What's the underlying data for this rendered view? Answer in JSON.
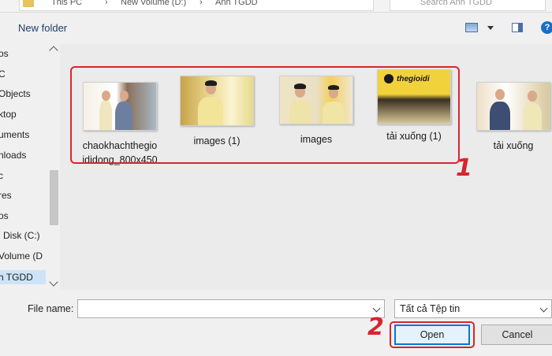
{
  "address": {
    "path_parts": [
      "This PC",
      "New Volume (D:)",
      "Anh TGDD"
    ],
    "separators": [
      "›",
      "›"
    ],
    "search_placeholder": "Search Anh TGDD"
  },
  "toolbar": {
    "new_folder": "New folder",
    "help": "?"
  },
  "nav": {
    "items": [
      "os",
      "C",
      "Objects",
      "ktop",
      "uments",
      "nloads",
      "c",
      "res",
      "os",
      "l Disk (C:)",
      "Volume (D",
      "h TGDD"
    ],
    "selected_index": 11
  },
  "files": [
    {
      "name_line1": "chaokhachthegio",
      "name_line2": "ididong_800x450"
    },
    {
      "name_line1": "images (1)",
      "name_line2": ""
    },
    {
      "name_line1": "images",
      "name_line2": ""
    },
    {
      "name_line1": "tải xuống (1)",
      "name_line2": ""
    },
    {
      "name_line1": "tải xuống",
      "name_line2": ""
    }
  ],
  "thumb4_logo": "thegioidi",
  "callouts": {
    "one": "1",
    "two": "2"
  },
  "bottom": {
    "file_name_label": "File name:",
    "file_name_value": "",
    "file_type": "Tất cả Tệp tin",
    "open": "Open",
    "cancel": "Cancel"
  },
  "colors": {
    "highlight": "#d7252e",
    "accent": "#0078d7"
  }
}
